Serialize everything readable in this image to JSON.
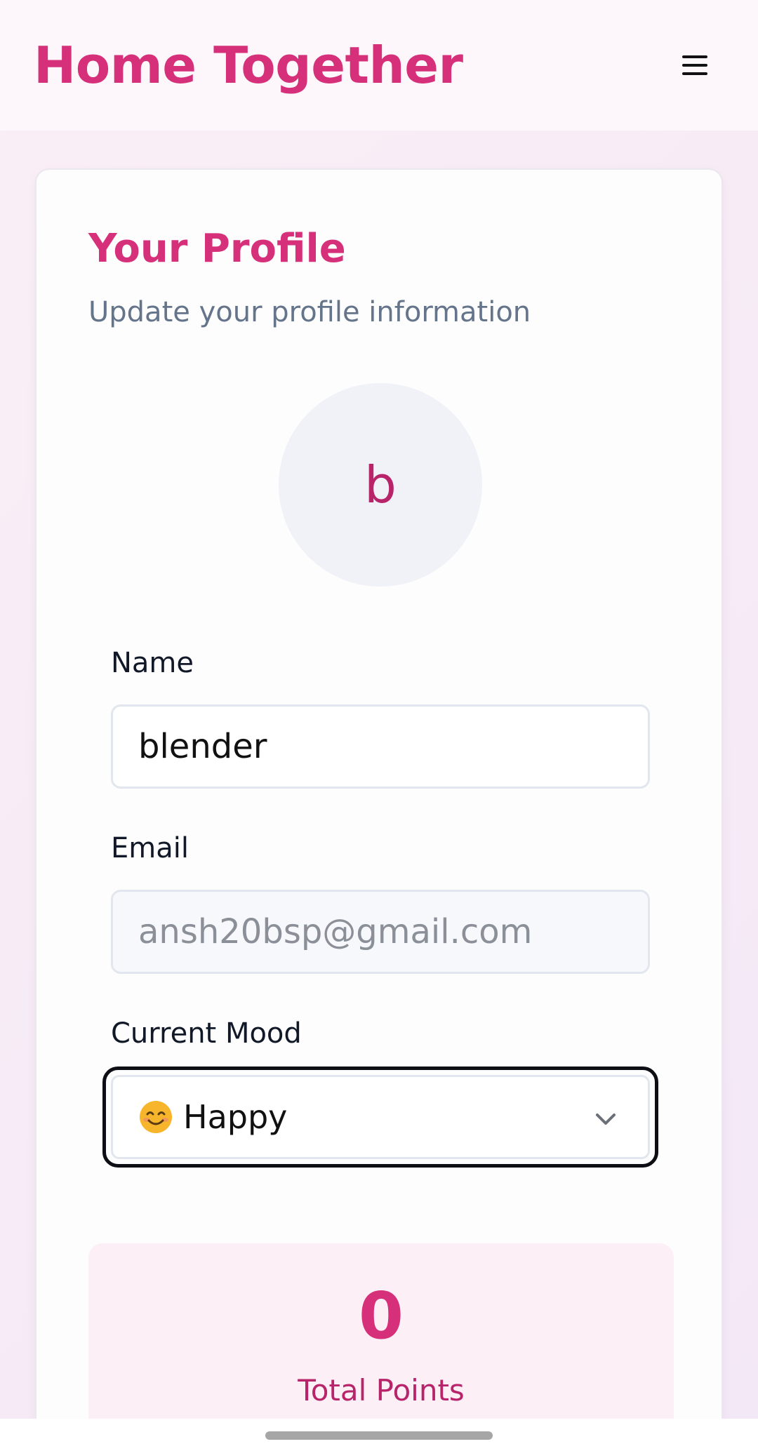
{
  "header": {
    "app_title": "Home Together",
    "menu_icon": "hamburger-menu-icon"
  },
  "profile": {
    "title": "Your Profile",
    "subtitle": "Update your profile information",
    "avatar_initial": "b"
  },
  "form": {
    "name_label": "Name",
    "name_value": "blender",
    "email_label": "Email",
    "email_value": "ansh20bsp@gmail.com",
    "mood_label": "Current Mood",
    "mood_value": "Happy",
    "mood_emoji_icon": "smiling-face-icon"
  },
  "stats": {
    "points_value": "0",
    "points_label": "Total Points"
  },
  "colors": {
    "accent": "#d6307a",
    "accent_dark": "#b8246a",
    "muted_text": "#64748b",
    "background": "#f5e9f5"
  }
}
